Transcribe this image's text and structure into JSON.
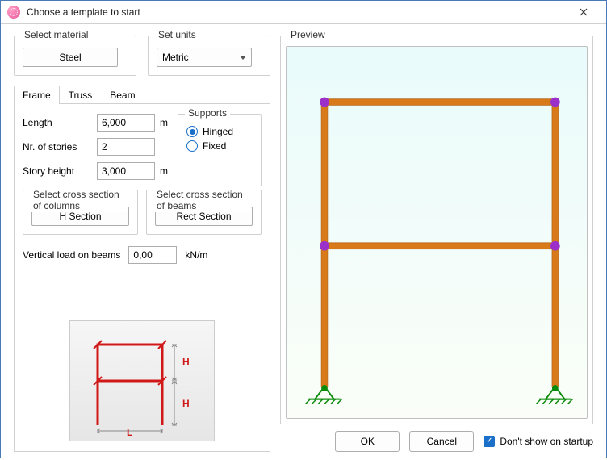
{
  "title": "Choose a template to start",
  "material": {
    "label": "Select material",
    "value": "Steel"
  },
  "units": {
    "label": "Set units",
    "value": "Metric"
  },
  "tabs": [
    "Frame",
    "Truss",
    "Beam"
  ],
  "active_tab": 0,
  "frame": {
    "length": {
      "label": "Length",
      "value": "6,000",
      "unit": "m"
    },
    "stories": {
      "label": "Nr. of stories",
      "value": "2"
    },
    "story_height": {
      "label": "Story height",
      "value": "3,000",
      "unit": "m"
    },
    "supports": {
      "label": "Supports",
      "options": [
        "Hinged",
        "Fixed"
      ],
      "selected": "Hinged"
    },
    "columns_cs": {
      "label": "Select cross section of columns",
      "value": "H Section"
    },
    "beams_cs": {
      "label": "Select cross section of beams",
      "value": "Rect Section"
    },
    "vload": {
      "label": "Vertical load on beams",
      "value": "0,00",
      "unit": "kN/m"
    }
  },
  "preview_label": "Preview",
  "diagram": {
    "L": "L",
    "H": "H"
  },
  "footer": {
    "ok": "OK",
    "cancel": "Cancel",
    "dont_show": "Don't show on startup",
    "dont_show_checked": true
  }
}
